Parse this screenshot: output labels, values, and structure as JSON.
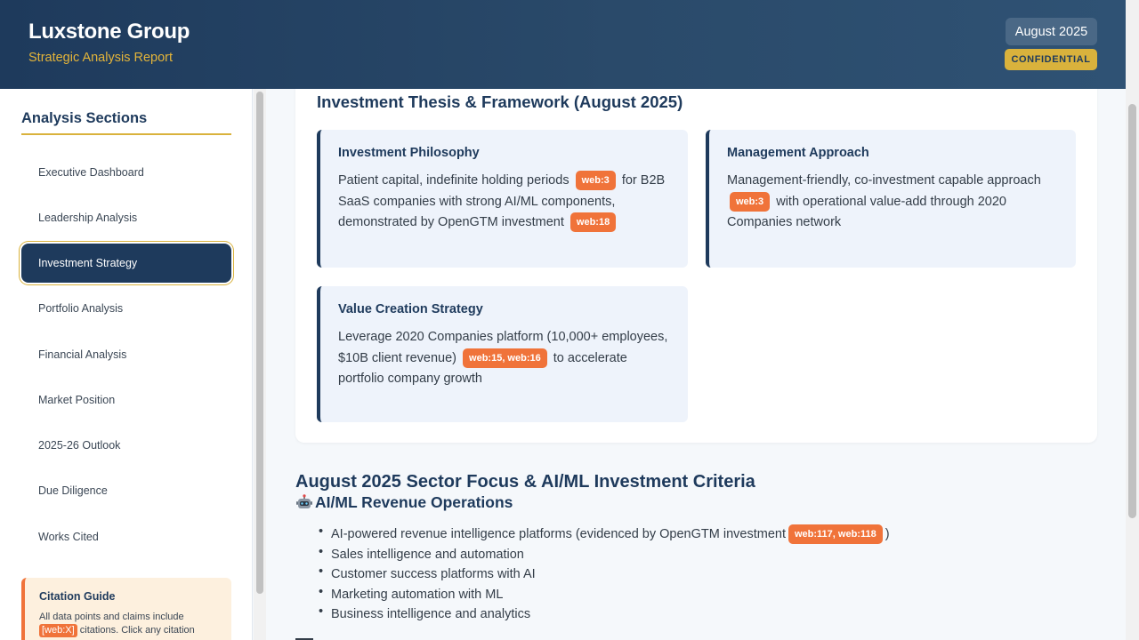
{
  "header": {
    "brand": "Luxstone Group",
    "subtitle": "Strategic Analysis Report",
    "date": "August 2025",
    "confidential": "CONFIDENTIAL"
  },
  "sidebar": {
    "title": "Analysis Sections",
    "items": [
      {
        "label": "Executive Dashboard"
      },
      {
        "label": "Leadership Analysis"
      },
      {
        "label": "Investment Strategy"
      },
      {
        "label": "Portfolio Analysis"
      },
      {
        "label": "Financial Analysis"
      },
      {
        "label": "Market Position"
      },
      {
        "label": "2025-26 Outlook"
      },
      {
        "label": "Due Diligence"
      },
      {
        "label": "Works Cited"
      }
    ],
    "active_item": "Investment Strategy",
    "citation_guide": {
      "title": "Citation Guide",
      "text_before": "All data points and claims include",
      "code": "[web:X]",
      "text_after": "citations. Click any citation"
    }
  },
  "main": {
    "card_title": "Investment Thesis & Framework (August 2025)",
    "boxes": [
      {
        "title": "Investment Philosophy",
        "p1": "Patient capital, indefinite holding periods",
        "tag1": "web:3",
        "p2": "for B2B SaaS companies with strong AI/ML components, demonstrated by OpenGTM investment",
        "tag2": "web:18"
      },
      {
        "title": "Management Approach",
        "p1": "Management-friendly, co-investment capable approach",
        "tag1": "web:3",
        "p2": "with operational value-add through 2020 Companies network"
      },
      {
        "title": "Value Creation Strategy",
        "p1": "Leverage 2020 Companies platform (10,000+ employees, $10B client revenue)",
        "tag1": "web:15, web:16",
        "p2": "to accelerate portfolio company growth"
      }
    ],
    "section_heading": "August 2025 Sector Focus & AI/ML Investment Criteria",
    "sub_heading": "AI/ML Revenue Operations",
    "sub_heading_icon": "robot-icon",
    "bullets": [
      {
        "text": "AI-powered revenue intelligence platforms (evidenced by OpenGTM investment",
        "tag": "web:117, web:118",
        "after": ")"
      },
      {
        "text": "Sales intelligence and automation"
      },
      {
        "text": "Customer success platforms with AI"
      },
      {
        "text": "Marketing automation with ML"
      },
      {
        "text": "Business intelligence and analytics"
      }
    ]
  },
  "colors": {
    "navy": "#1e3a5c",
    "gold": "#d9b23c",
    "citation_orange": "#f0733a",
    "box_bg": "#eef3fb"
  }
}
